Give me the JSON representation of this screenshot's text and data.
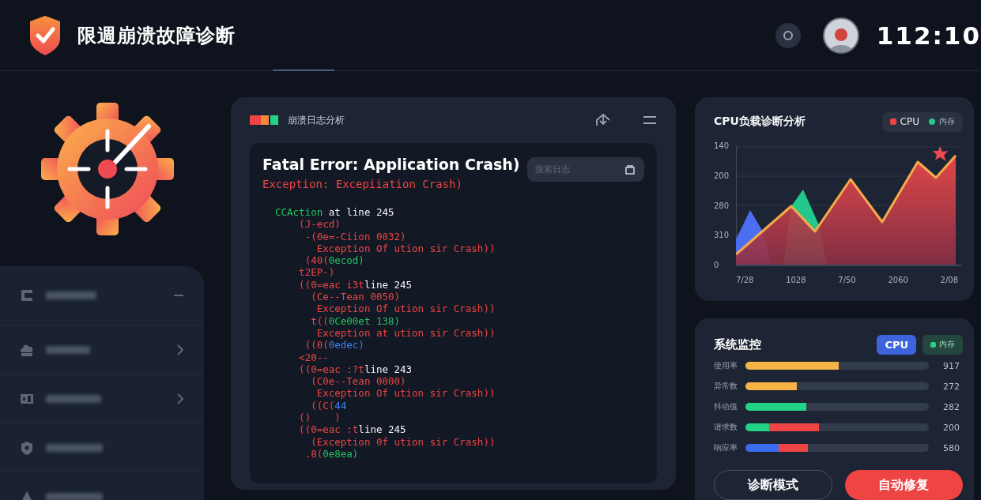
{
  "header": {
    "title": "限週崩溃故障诊断",
    "clock": "112:10"
  },
  "sidebar": {
    "items": [
      {
        "kind": "open"
      },
      {
        "kind": "closed"
      },
      {
        "kind": "closed"
      },
      {
        "kind": "plain"
      },
      {
        "kind": "plain"
      }
    ]
  },
  "log_panel": {
    "title": "崩溃日志分析",
    "search": {
      "placeholder": "搜索日志"
    },
    "error_title": "Fatal Error: Application Crash)",
    "exception": "Exception: Excepiiation Crash)",
    "lines": [
      {
        "parts": [
          {
            "text": "CCAction",
            "color": "#22c55e"
          },
          {
            "text": " at line 245",
            "color": "#f3f4f6"
          }
        ]
      },
      {
        "parts": [
          {
            "text": "    (J-ecd)",
            "color": "#ef4444"
          }
        ]
      },
      {
        "parts": [
          {
            "text": "     -(0e=-Ciion 0032)",
            "color": "#ef4444"
          }
        ]
      },
      {
        "parts": [
          {
            "text": "       Exception Of ution sir Crash))",
            "color": "#ef4444"
          }
        ]
      },
      {
        "parts": [
          {
            "text": "     (40(",
            "color": "#ef4444"
          },
          {
            "text": "0ecod)",
            "color": "#22c55e"
          }
        ]
      },
      {
        "parts": [
          {
            "text": "    t2EP-)",
            "color": "#ef4444"
          }
        ]
      },
      {
        "parts": [
          {
            "text": "    ((0=eac i3t",
            "color": "#ef4444"
          },
          {
            "text": "line 245",
            "color": "#f3f4f6"
          }
        ]
      },
      {
        "parts": [
          {
            "text": "      (Ce--Tean 0050)",
            "color": "#ef4444"
          }
        ]
      },
      {
        "parts": [
          {
            "text": "       Exception Of ution sir Crash))",
            "color": "#ef4444"
          }
        ]
      },
      {
        "parts": [
          {
            "text": "      t((",
            "color": "#ef4444"
          },
          {
            "text": "0Ce00et 138)",
            "color": "#22c55e"
          }
        ]
      },
      {
        "parts": [
          {
            "text": "       Exception at ution sir Crash))",
            "color": "#ef4444"
          }
        ]
      },
      {
        "parts": [
          {
            "text": "     ((0(",
            "color": "#ef4444"
          },
          {
            "text": "0edec)",
            "color": "#3b82f6"
          }
        ]
      },
      {
        "parts": [
          {
            "text": "    <20--",
            "color": "#ef4444"
          }
        ]
      },
      {
        "parts": [
          {
            "text": "    ((0=eac :?t",
            "color": "#ef4444"
          },
          {
            "text": "line 243",
            "color": "#f3f4f6"
          }
        ]
      },
      {
        "parts": [
          {
            "text": "      (C0e--Tean 0000)",
            "color": "#ef4444"
          }
        ]
      },
      {
        "parts": [
          {
            "text": "       Exception Of ution sir Crash))",
            "color": "#ef4444"
          }
        ]
      },
      {
        "parts": [
          {
            "text": "      ((C(",
            "color": "#ef4444"
          },
          {
            "text": "44",
            "color": "#3b82f6"
          }
        ]
      },
      {
        "parts": [
          {
            "text": "    ()    )",
            "color": "#ef4444"
          }
        ]
      },
      {
        "parts": [
          {
            "text": "    ((0=eac :t",
            "color": "#ef4444"
          },
          {
            "text": "line 245",
            "color": "#f3f4f6"
          }
        ]
      },
      {
        "parts": [
          {
            "text": "      (Exception 0f ution sir Crash))",
            "color": "#ef4444"
          }
        ]
      },
      {
        "parts": [
          {
            "text": "     .8(",
            "color": "#ef4444"
          },
          {
            "text": "0e8ea)",
            "color": "#22c55e"
          }
        ]
      }
    ]
  },
  "chart_card": {
    "title": "CPU负载诊断分析",
    "legend": [
      {
        "label": "CPU",
        "color": "#ef4444"
      },
      {
        "label": "内存",
        "color": "#22c98a"
      }
    ],
    "y_labels": [
      "140",
      "200",
      "280",
      "310",
      "0"
    ],
    "x_labels": [
      "7/28",
      "1028",
      "7/50",
      "2060",
      "2/08"
    ]
  },
  "stats_card": {
    "title": "系统监控",
    "chips": [
      {
        "label": "CPU",
        "selected": true
      },
      {
        "label": "内存",
        "selected": false
      }
    ],
    "bars": [
      {
        "label": "使用率",
        "reading": "917",
        "segments": [
          {
            "color": "#f6b447",
            "level": 0.51
          }
        ]
      },
      {
        "label": "异常数",
        "reading": "272",
        "segments": [
          {
            "color": "#f6b447",
            "level": 0.28
          }
        ]
      },
      {
        "label": "抖动值",
        "reading": "282",
        "segments": [
          {
            "color": "#22d386",
            "level": 0.33
          }
        ]
      },
      {
        "label": "请求数",
        "reading": "200",
        "segments": [
          {
            "color": "#22d386",
            "level": 0.13
          },
          {
            "color": "#ef4444",
            "level": 0.27
          }
        ]
      },
      {
        "label": "响应率",
        "reading": "580",
        "segments": [
          {
            "color": "#3b6cf0",
            "level": 0.18
          },
          {
            "color": "#ef4444",
            "level": 0.16
          }
        ]
      }
    ]
  },
  "buttons": [
    {
      "label": "诊断模式",
      "kind": "outline"
    },
    {
      "label": "自动修复",
      "kind": "primary"
    }
  ]
}
